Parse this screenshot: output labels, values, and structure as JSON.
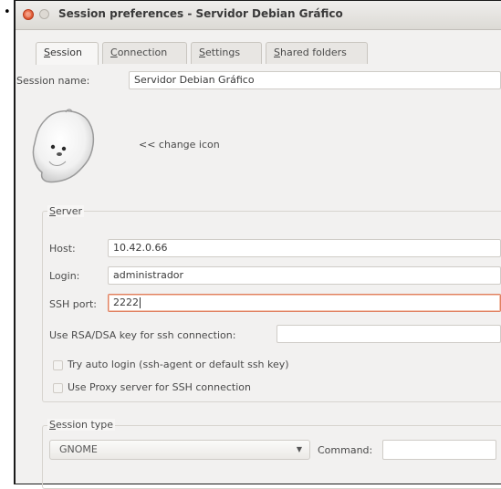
{
  "window": {
    "title": "Session preferences - Servidor Debian Gráfico"
  },
  "tabs": [
    {
      "label": "Session",
      "mnemonic": "S",
      "rest": "ession"
    },
    {
      "label": "Connection",
      "mnemonic": "C",
      "rest": "onnection"
    },
    {
      "label": "Settings",
      "mnemonic": "S",
      "rest": "ettings"
    },
    {
      "label": "Shared folders",
      "mnemonic": "S",
      "rest": "hared folders"
    }
  ],
  "session": {
    "name_label": "Session name:",
    "name_value": "Servidor Debian Gráfico",
    "change_icon_label": "<< change icon"
  },
  "server": {
    "frame_label": "Server",
    "frame_label_mnemonic": "S",
    "frame_label_rest": "erver",
    "host_label": "Host:",
    "host_value": "10.42.0.66",
    "login_label": "Login:",
    "login_value": "administrador",
    "ssh_port_label": "SSH port:",
    "ssh_port_value": "2222",
    "rsa_label": "Use RSA/DSA key for ssh connection:",
    "rsa_value": "",
    "auto_login_label": "Try auto login (ssh-agent or default ssh key)",
    "auto_login_checked": false,
    "proxy_label": "Use Proxy server for SSH connection",
    "proxy_checked": false
  },
  "session_type": {
    "frame_label": "Session type",
    "frame_label_mnemonic": "S",
    "frame_label_rest": "ession type",
    "selected": "GNOME",
    "command_label": "Command:",
    "command_value": ""
  },
  "icons": {
    "close": "close-icon",
    "minimize": "minimize-icon",
    "session_icon": "seal-mascot-icon",
    "dropdown": "chevron-down-icon"
  },
  "colors": {
    "close_button": "#d5451c",
    "focus_border": "#e08060"
  }
}
